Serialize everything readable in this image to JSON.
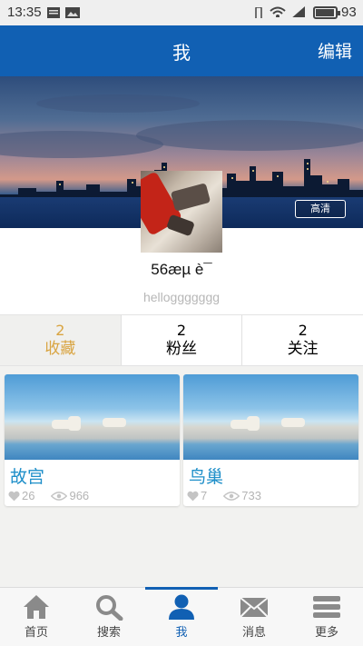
{
  "status_bar": {
    "time": "13:35",
    "battery": "93",
    "battery_level": 0.93
  },
  "header": {
    "title": "我",
    "edit_label": "编辑"
  },
  "banner": {
    "hd_label": "高清"
  },
  "profile": {
    "username": "56æµ è¯",
    "signature": "helloggggggg"
  },
  "stats": [
    {
      "count": "2",
      "label": "收藏"
    },
    {
      "count": "2",
      "label": "粉丝"
    },
    {
      "count": "2",
      "label": "关注"
    }
  ],
  "cards": [
    {
      "name": "故宫",
      "likes": "26",
      "views": "966"
    },
    {
      "name": "鸟巢",
      "likes": "7",
      "views": "733"
    }
  ],
  "tabs": [
    {
      "label": "首页",
      "icon": "home-icon"
    },
    {
      "label": "搜索",
      "icon": "search-icon"
    },
    {
      "label": "我",
      "icon": "user-icon"
    },
    {
      "label": "消息",
      "icon": "message-icon"
    },
    {
      "label": "更多",
      "icon": "more-icon"
    }
  ],
  "colors": {
    "primary": "#1160b3",
    "accent": "#d9a441",
    "card_title": "#1f8fc9"
  }
}
